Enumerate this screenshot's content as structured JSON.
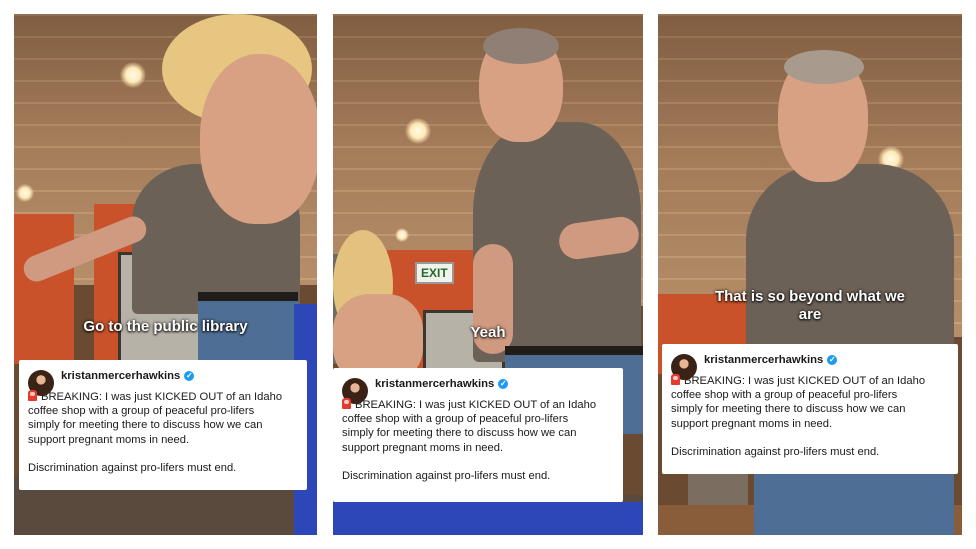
{
  "panels": [
    {
      "caption": "Go to the public library",
      "post": {
        "username": "kristanmercerhawkins",
        "text": "BREAKING: I was just KICKED OUT of an Idaho\ncoffee shop with a group of peaceful pro-lifers\nsimply for meeting there to discuss how we can\nsupport pregnant moms in need.",
        "closing": "Discrimination against pro-lifers must end."
      }
    },
    {
      "caption": "Yeah",
      "sign": "EXIT",
      "post": {
        "username": "kristanmercerhawkins",
        "text": "BREAKING: I was just KICKED OUT of an Idaho\ncoffee shop with a group of peaceful pro-lifers\nsimply for meeting there to discuss how we can\nsupport pregnant moms in need.",
        "closing": "Discrimination against pro-lifers must end."
      }
    },
    {
      "caption": "That is so beyond what we\nare",
      "post": {
        "username": "kristanmercerhawkins",
        "text": "BREAKING: I was just KICKED OUT of an Idaho\ncoffee shop with a group of peaceful pro-lifers\nsimply for meeting there to discuss how we can\nsupport pregnant moms in need.",
        "closing": "Discrimination against pro-lifers must end."
      }
    }
  ],
  "icons": {
    "verified": "verified-badge-icon",
    "alert": "siren-icon"
  },
  "colors": {
    "verified": "#1d9bf0",
    "siren": "#e53a2f"
  }
}
